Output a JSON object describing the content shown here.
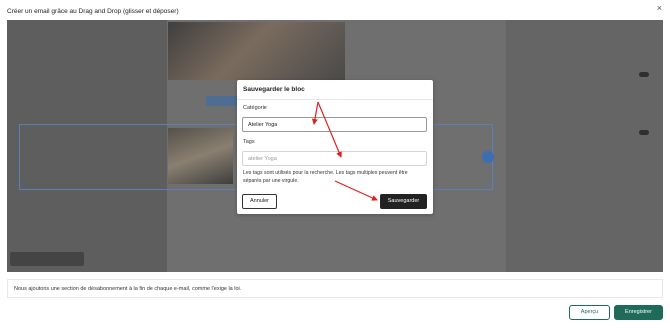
{
  "window": {
    "title": "Créer un email grâce au Drag and Drop (glisser et déposer)",
    "close_glyph": "×"
  },
  "modal": {
    "title": "Sauvegarder le bloc",
    "category_label": "Catégorie",
    "category_value": "Atelier Yoga",
    "tags_label": "Tags",
    "tags_placeholder": "atelier Yoga",
    "help_text": "Les tags sont utilisés pour la recherche. Les tags multiples peuvent être séparés par une virgule.",
    "cancel_label": "Annuler",
    "save_label": "Sauvegarder"
  },
  "footer": {
    "notice": "Nous ajoutons une section de désabonnement à la fin de chaque e-mail, comme l'exige la loi.",
    "preview_label": "Aperçu",
    "save_label": "Enregistrer"
  },
  "colors": {
    "accent": "#1f6b5a",
    "arrow": "#e02020",
    "overlay": "#5e5e5e"
  },
  "icons": [
    "close-icon",
    "arrow-annotation"
  ]
}
